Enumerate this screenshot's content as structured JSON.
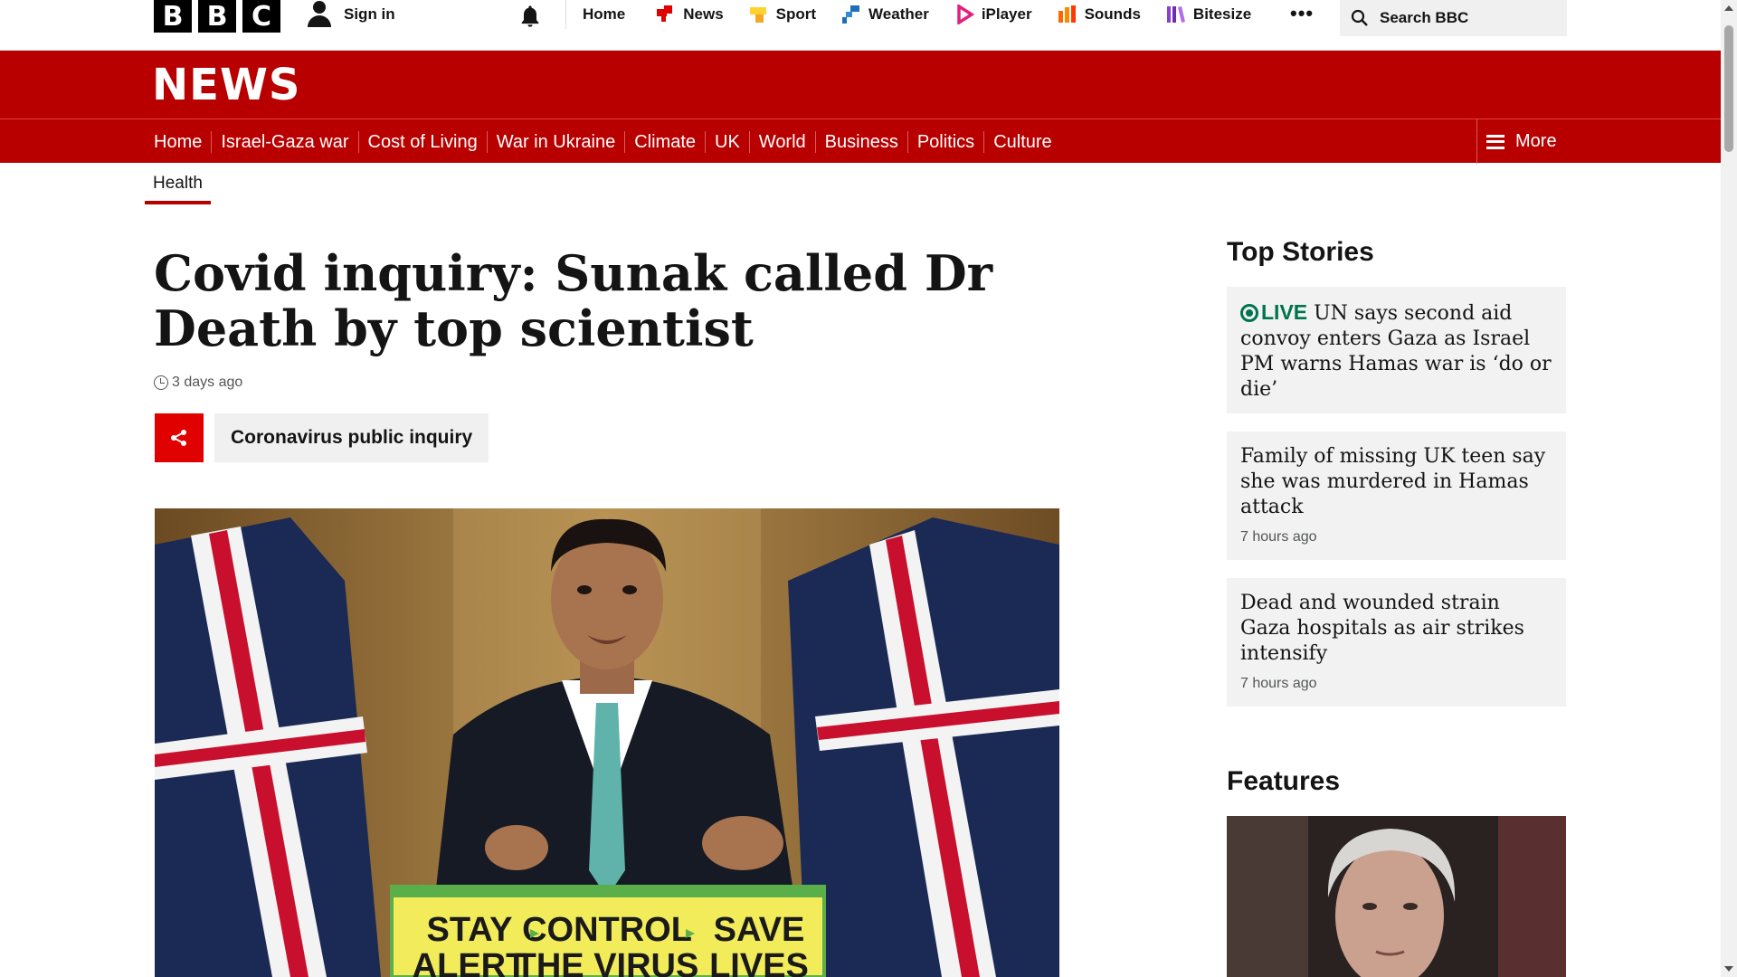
{
  "masthead": {
    "logo_letters": [
      "B",
      "B",
      "C"
    ],
    "sign_in": "Sign in",
    "nav": [
      {
        "label": "Home",
        "icon": "none"
      },
      {
        "label": "News",
        "icon": "news-icon",
        "color": "#e00000"
      },
      {
        "label": "Sport",
        "icon": "sport-icon",
        "color": "#ffd230"
      },
      {
        "label": "Weather",
        "icon": "weather-icon",
        "color": "#1d6eb5"
      },
      {
        "label": "iPlayer",
        "icon": "iplayer-icon",
        "color": "#e0207d"
      },
      {
        "label": "Sounds",
        "icon": "sounds-icon",
        "color": "#ff6600"
      },
      {
        "label": "Bitesize",
        "icon": "bitesize-icon",
        "color": "#8f3fd0"
      }
    ],
    "more_dots": "•••",
    "search_placeholder": "Search BBC"
  },
  "news_bar": {
    "title": "NEWS",
    "sections": [
      "Home",
      "Israel-Gaza war",
      "Cost of Living",
      "War in Ukraine",
      "Climate",
      "UK",
      "World",
      "Business",
      "Politics",
      "Culture"
    ],
    "more_label": "More",
    "sub_section": "Health"
  },
  "article": {
    "headline": "Covid inquiry: Sunak called Dr Death by top scientist",
    "timestamp": "3 days ago",
    "topic_tag": "Coronavirus public inquiry",
    "image_sign_line1": [
      "STAY",
      "CONTROL",
      "SAVE"
    ],
    "image_sign_line2": [
      "ALERT",
      "THE VIRUS",
      "LIVES"
    ]
  },
  "sidebar": {
    "top_stories_heading": "Top Stories",
    "stories": [
      {
        "live": "LIVE",
        "title": "UN says second aid convoy enters Gaza as Israel PM warns Hamas war is ‘do or die’",
        "time": ""
      },
      {
        "live": "",
        "title": "Family of missing UK teen say she was murdered in Hamas attack",
        "time": "7 hours ago"
      },
      {
        "live": "",
        "title": "Dead and wounded strain Gaza hospitals as air strikes intensify",
        "time": "7 hours ago"
      }
    ],
    "features_heading": "Features"
  },
  "colors": {
    "bbc_red": "#b80000",
    "share_red": "#e00000",
    "live_green": "#00744e"
  }
}
